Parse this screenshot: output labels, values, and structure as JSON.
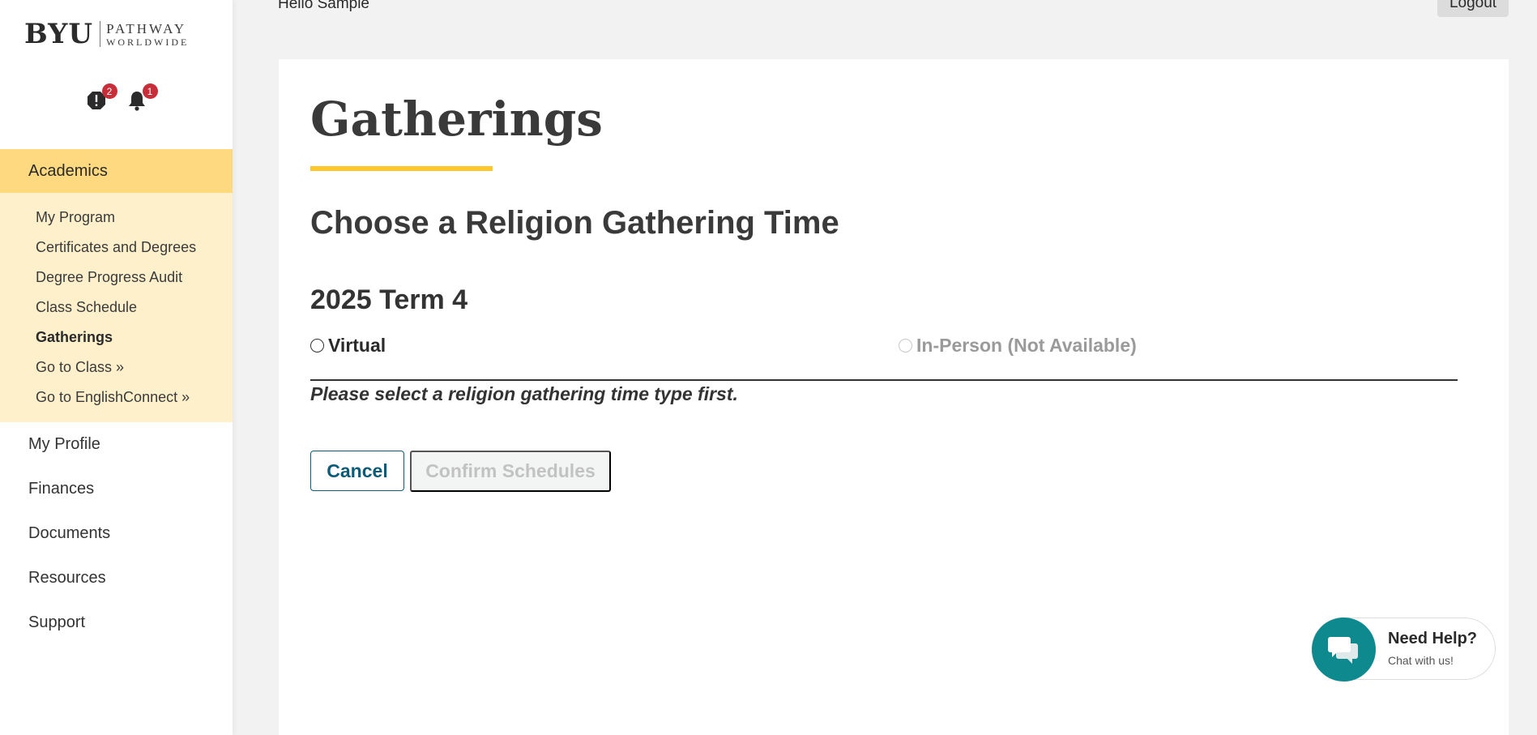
{
  "header": {
    "greeting": "Hello Sample",
    "logout_label": "Logout"
  },
  "logo": {
    "brand": "BYU",
    "line1": "PATHWAY",
    "line2": "WORLDWIDE"
  },
  "notifications": {
    "alerts_count": "2",
    "bell_count": "1"
  },
  "sidebar": {
    "section_label": "Academics",
    "subitems": [
      {
        "label": "My Program"
      },
      {
        "label": "Certificates and Degrees"
      },
      {
        "label": "Degree Progress Audit"
      },
      {
        "label": "Class Schedule"
      },
      {
        "label": "Gatherings"
      },
      {
        "label": "Go to Class »"
      },
      {
        "label": "Go to EnglishConnect »"
      }
    ],
    "items": [
      {
        "label": "My Profile"
      },
      {
        "label": "Finances"
      },
      {
        "label": "Documents"
      },
      {
        "label": "Resources"
      },
      {
        "label": "Support"
      }
    ]
  },
  "main": {
    "title": "Gatherings",
    "subtitle": "Choose a Religion Gathering Time",
    "term": "2025 Term 4",
    "options": [
      {
        "label": "Virtual"
      },
      {
        "label": "In-Person (Not Available)"
      }
    ],
    "hint": "Please select a religion gathering time type first.",
    "cancel_label": "Cancel",
    "confirm_label": "Confirm Schedules"
  },
  "help": {
    "title": "Need Help?",
    "subtitle": "Chat with us!"
  },
  "colors": {
    "accent_yellow": "#ffc72c",
    "section_bg": "#ffd97f",
    "submenu_bg": "#fff0cc",
    "primary_teal": "#0c5b78",
    "help_teal": "#0e8a8f",
    "badge_red": "#c62f3a"
  },
  "icons": [
    "alert-octagon-icon",
    "bell-icon",
    "chat-bubbles-icon"
  ]
}
